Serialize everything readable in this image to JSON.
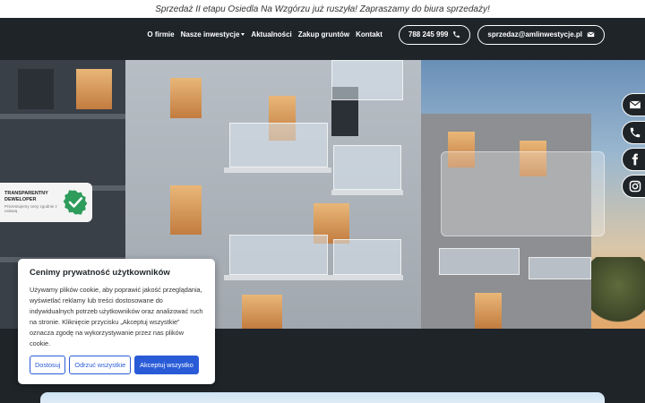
{
  "announcement": "Sprzedaż II etapu Osiedla Na Wzgórzu już ruszyła! Zapraszamy do biura sprzedaży!",
  "nav": {
    "items": [
      {
        "label": "O firmie"
      },
      {
        "label": "Nasze inwestycje",
        "has_dropdown": true
      },
      {
        "label": "Aktualności"
      },
      {
        "label": "Zakup gruntów"
      },
      {
        "label": "Kontakt"
      }
    ],
    "phone": "788 245 999",
    "email": "sprzedaz@amlinwestycje.pl"
  },
  "hero": {
    "badge": {
      "title": "TRANSPARENTNY DEWELOPER",
      "subtitle": "Prezentujemy ceny zgodnie z ustawą"
    }
  },
  "social": [
    "mail-icon",
    "phone-icon",
    "facebook-icon",
    "instagram-icon"
  ],
  "cookie": {
    "title": "Cenimy prywatność użytkowników",
    "body": "Używamy plików cookie, aby poprawić jakość przeglądania, wyświetlać reklamy lub treści dostosowane do indywidualnych potrzeb użytkowników oraz analizować ruch na stronie. Kliknięcie przycisku „Akceptuj wszystkie” oznacza zgodę na wykorzystywanie przez nas plików cookie.",
    "buttons": {
      "customize": "Dostosuj",
      "reject": "Odrzuć wszystkie",
      "accept": "Akceptuj wszystko"
    }
  },
  "colors": {
    "nav_bg": "#1f2429",
    "accent_blue": "#2a5bd7",
    "badge_green": "#2e9c5b"
  }
}
